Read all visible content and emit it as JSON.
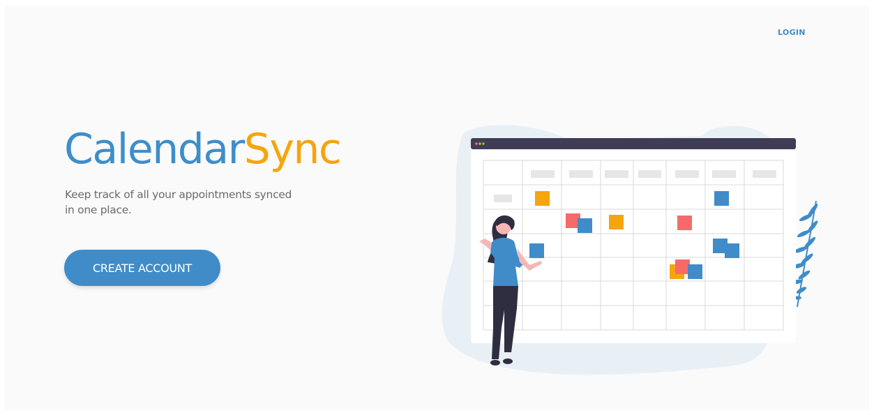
{
  "header": {
    "login_label": "LOGIN"
  },
  "hero": {
    "brand_part_1": "Calendar",
    "brand_part_2": "Sync",
    "tagline": "Keep track of all your appointments synced in one place.",
    "cta_label": "CREATE ACCOUNT"
  },
  "colors": {
    "brand_blue": "#3d8ec9",
    "brand_orange": "#f5a50d",
    "accent_red": "#f76a6a",
    "button_blue": "#3f8cc9",
    "calendar_header": "#3f3d56",
    "blob": "#e8f0f6"
  },
  "illustration": {
    "icon": "calendar-with-woman-illustration"
  }
}
